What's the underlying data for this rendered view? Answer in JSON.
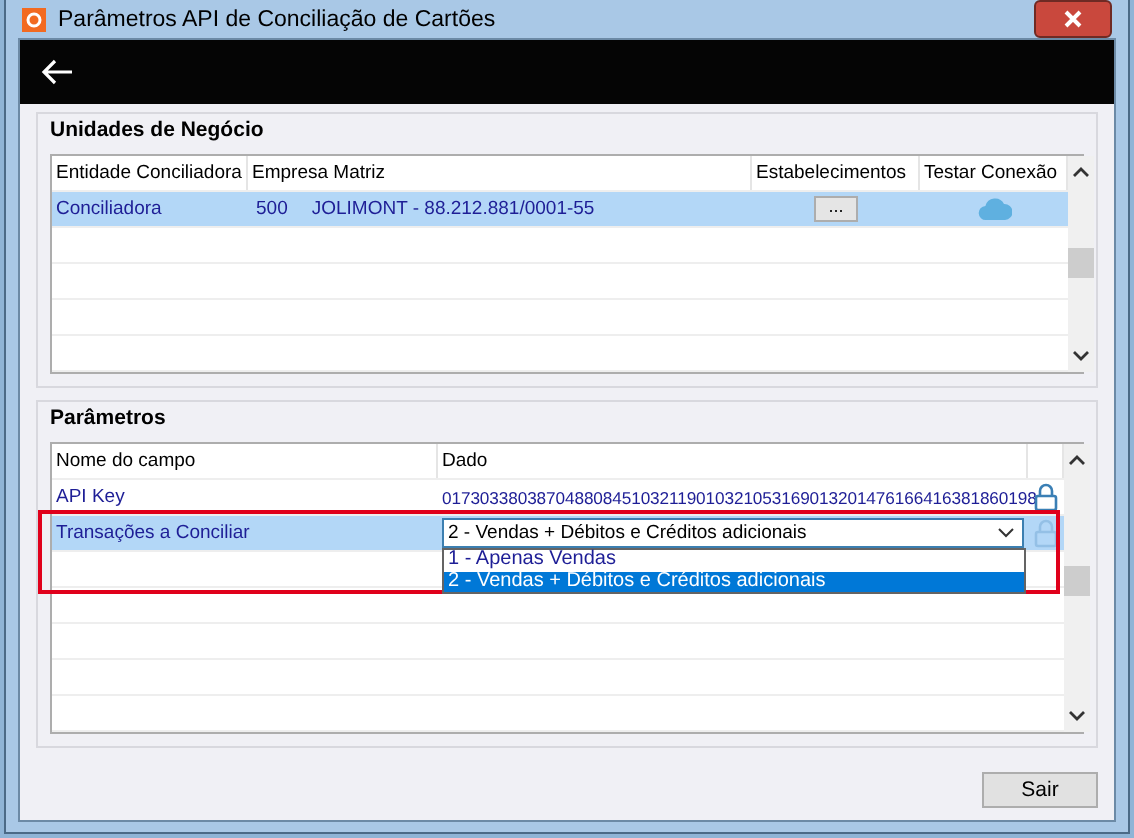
{
  "window": {
    "title": "Parâmetros API de Conciliação de Cartões"
  },
  "business_units": {
    "title": "Unidades de Negócio",
    "columns": [
      "Entidade Conciliadora",
      "Empresa Matriz",
      "Estabelecimentos",
      "Testar Conexão"
    ],
    "rows": [
      {
        "entity": "Conciliadora",
        "company": "500",
        "matrix": "JOLIMONT - 88.212.881/0001-55",
        "establishments_button": "...",
        "selected": true
      }
    ]
  },
  "parameters": {
    "title": "Parâmetros",
    "columns": [
      "Nome do campo",
      "Dado"
    ],
    "rows": [
      {
        "kind": "text",
        "name": "API Key",
        "value": "017303380387048808451032119010321053169013201476166416381860198",
        "selected": false
      },
      {
        "kind": "dropdown",
        "name": "Transações a Conciliar",
        "value": "2 - Vendas + Débitos e Créditos adicionais",
        "selected": true,
        "options": [
          {
            "label": "1 - Apenas Vendas",
            "selected": false
          },
          {
            "label": "2 - Vendas + Débitos e Créditos adicionais",
            "selected": true
          }
        ]
      }
    ]
  },
  "buttons": [
    "Sair"
  ]
}
